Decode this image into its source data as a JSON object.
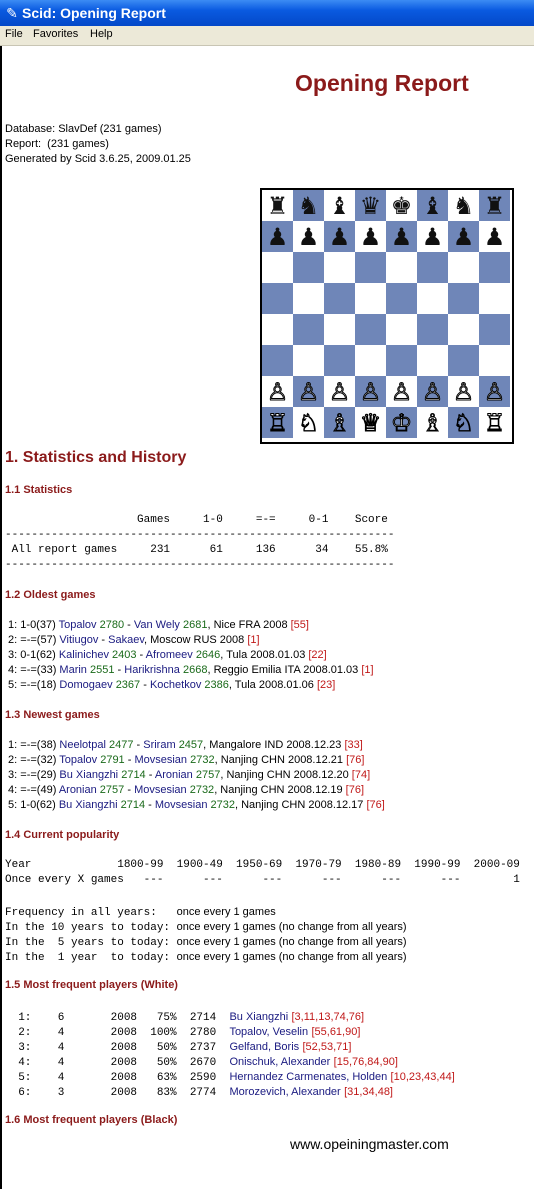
{
  "window": {
    "title": "Scid: Opening Report",
    "icon": "feather-icon"
  },
  "menu": [
    "File",
    "Favorites",
    "Help"
  ],
  "report": {
    "heading": "Opening Report",
    "database": "Database: SlavDef (231 games)",
    "report_line": "Report:  (231 games)",
    "generated": "Generated by Scid 3.6.25, 2009.01.25"
  },
  "board": [
    [
      "r",
      "n",
      "b",
      "q",
      "k",
      "b",
      "n",
      "r"
    ],
    [
      "p",
      "p",
      "p",
      "p",
      "p",
      "p",
      "p",
      "p"
    ],
    [
      "",
      "",
      "",
      "",
      "",
      "",
      "",
      ""
    ],
    [
      "",
      "",
      "",
      "",
      "",
      "",
      "",
      ""
    ],
    [
      "",
      "",
      "",
      "",
      "",
      "",
      "",
      ""
    ],
    [
      "",
      "",
      "",
      "",
      "",
      "",
      "",
      ""
    ],
    [
      "P",
      "P",
      "P",
      "P",
      "P",
      "P",
      "P",
      "P"
    ],
    [
      "R",
      "N",
      "B",
      "Q",
      "K",
      "B",
      "N",
      "R"
    ]
  ],
  "section1": "1. Statistics and History",
  "s11": {
    "title": "1.1 Statistics",
    "header": "                    Games     1-0     =-=     0-1    Score",
    "rule": "-----------------------------------------------------------",
    "row": " All report games     231      61     136      34    55.8%"
  },
  "s12": {
    "title": "1.2 Oldest games",
    "games": [
      {
        "pre": " 1: 1-0(37) ",
        "w": "Topalov",
        "we": "2780",
        "sep": " - ",
        "b": "Van Wely",
        "be": "2681",
        "info": ", Nice FRA 2008 ",
        "ref": "[55]"
      },
      {
        "pre": " 2: =-=(57) ",
        "w": "Vitiugov",
        "we": "",
        "sep": " - ",
        "b": "Sakaev",
        "be": "",
        "info": ", Moscow RUS 2008 ",
        "ref": "[1]"
      },
      {
        "pre": " 3: 0-1(62) ",
        "w": "Kalinichev",
        "we": "2403",
        "sep": " - ",
        "b": "Afromeev",
        "be": "2646",
        "info": ", Tula 2008.01.03 ",
        "ref": "[22]"
      },
      {
        "pre": " 4: =-=(33) ",
        "w": "Marin",
        "we": "2551",
        "sep": " - ",
        "b": "Harikrishna",
        "be": "2668",
        "info": ", Reggio Emilia ITA 2008.01.03 ",
        "ref": "[1]"
      },
      {
        "pre": " 5: =-=(18) ",
        "w": "Domogaev",
        "we": "2367",
        "sep": " - ",
        "b": "Kochetkov",
        "be": "2386",
        "info": ", Tula 2008.01.06 ",
        "ref": "[23]"
      }
    ]
  },
  "s13": {
    "title": "1.3 Newest games",
    "games": [
      {
        "pre": " 1: =-=(38) ",
        "w": "Neelotpal",
        "we": "2477",
        "sep": " - ",
        "b": "Sriram",
        "be": "2457",
        "info": ", Mangalore IND 2008.12.23 ",
        "ref": "[33]"
      },
      {
        "pre": " 2: =-=(32) ",
        "w": "Topalov",
        "we": "2791",
        "sep": " - ",
        "b": "Movsesian",
        "be": "2732",
        "info": ", Nanjing CHN 2008.12.21 ",
        "ref": "[76]"
      },
      {
        "pre": " 3: =-=(29) ",
        "w": "Bu Xiangzhi",
        "we": "2714",
        "sep": " - ",
        "b": "Aronian",
        "be": "2757",
        "info": ", Nanjing CHN 2008.12.20 ",
        "ref": "[74]"
      },
      {
        "pre": " 4: =-=(49) ",
        "w": "Aronian",
        "we": "2757",
        "sep": " - ",
        "b": "Movsesian",
        "be": "2732",
        "info": ", Nanjing CHN 2008.12.19 ",
        "ref": "[76]"
      },
      {
        "pre": " 5: 1-0(62) ",
        "w": "Bu Xiangzhi",
        "we": "2714",
        "sep": " - ",
        "b": "Movsesian",
        "be": "2732",
        "info": ", Nanjing CHN 2008.12.17 ",
        "ref": "[76]"
      }
    ]
  },
  "s14": {
    "title": "1.4 Current popularity",
    "year_row": "Year             1800-99  1900-49  1950-69  1970-79  1980-89  1990-99  2000-09",
    "every_row": "Once every X games   ---      ---      ---      ---      ---      ---        1",
    "freq": [
      {
        "label": "Frequency in all years:   ",
        "text": "once every 1 games"
      },
      {
        "label": "In the 10 years to today: ",
        "text": "once every 1 games (no change from all years)"
      },
      {
        "label": "In the  5 years to today: ",
        "text": "once every 1 games (no change from all years)"
      },
      {
        "label": "In the  1 year  to today: ",
        "text": "once every 1 games (no change from all years)"
      }
    ]
  },
  "s15": {
    "title": "1.5 Most frequent players (White)",
    "players": [
      {
        "stats": "  1:    6       2008   75%  2714  ",
        "name": "Bu Xiangzhi",
        "refs": "[3,11,13,74,76]"
      },
      {
        "stats": "  2:    4       2008  100%  2780  ",
        "name": "Topalov, Veselin",
        "refs": "[55,61,90]"
      },
      {
        "stats": "  3:    4       2008   50%  2737  ",
        "name": "Gelfand, Boris",
        "refs": "[52,53,71]"
      },
      {
        "stats": "  4:    4       2008   50%  2670  ",
        "name": "Onischuk, Alexander",
        "refs": "[15,76,84,90]"
      },
      {
        "stats": "  5:    4       2008   63%  2590  ",
        "name": "Hernandez Carmenates, Holden",
        "refs": "[10,23,43,44]"
      },
      {
        "stats": "  6:    3       2008   83%  2774  ",
        "name": "Morozevich, Alexander",
        "refs": "[31,34,48]"
      }
    ]
  },
  "s16": {
    "title": "1.6 Most frequent players (Black)"
  },
  "watermark": "www.opeiningmaster.com"
}
